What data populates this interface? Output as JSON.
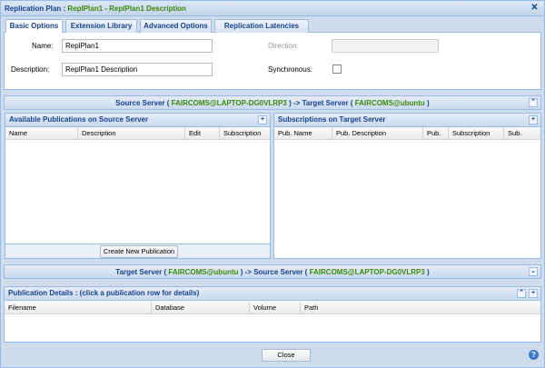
{
  "window": {
    "title_prefix": "Replication Plan :",
    "title_highlight": "ReplPlan1 - ReplPlan1 Description",
    "close_glyph": "✕"
  },
  "tabs": [
    {
      "label": "Basic Options",
      "active": true
    },
    {
      "label": "Extension Library",
      "active": false
    },
    {
      "label": "Advanced Options",
      "active": false
    },
    {
      "label": "Replication Latencies",
      "active": false
    }
  ],
  "basic": {
    "name_label": "Name:",
    "name_value": "ReplPlan1",
    "description_label": "Description:",
    "description_value": "ReplPlan1 Description",
    "direction_label": "Direction:",
    "direction_value": "",
    "synchronous_label": "Synchronous:"
  },
  "source_to_target": {
    "prefix": "Source Server (",
    "source": "FAIRCOMS@LAPTOP-DG0VLRP3",
    "middle": ") -> Target Server (",
    "target": "FAIRCOMS@ubuntu",
    "suffix": ")",
    "toggle_glyph": "⌃"
  },
  "available_publications": {
    "title": "Available Publications on Source Server",
    "columns": [
      "Name",
      "Description",
      "Edit",
      "Subscription"
    ],
    "create_button": "Create New Publication",
    "add_glyph": "+"
  },
  "subscriptions": {
    "title": "Subscriptions on Target Server",
    "columns": [
      "Pub. Name",
      "Pub. Description",
      "Pub.",
      "Subscription",
      "Sub."
    ],
    "add_glyph": "+"
  },
  "target_to_source": {
    "prefix": "Target Server (",
    "target": "FAIRCOMS@ubuntu",
    "middle": ") -> Source Server (",
    "source": "FAIRCOMS@LAPTOP-DG0VLRP3",
    "suffix": ")",
    "toggle_glyph": "⌄"
  },
  "publication_details": {
    "title": "Publication Details : (click a publication row for details)",
    "columns": [
      "Filename",
      "Database",
      "Volume",
      "Path"
    ],
    "collapse_glyph": "⌃",
    "add_glyph": "+"
  },
  "footer": {
    "close_button": "Close",
    "help_glyph": "?"
  }
}
